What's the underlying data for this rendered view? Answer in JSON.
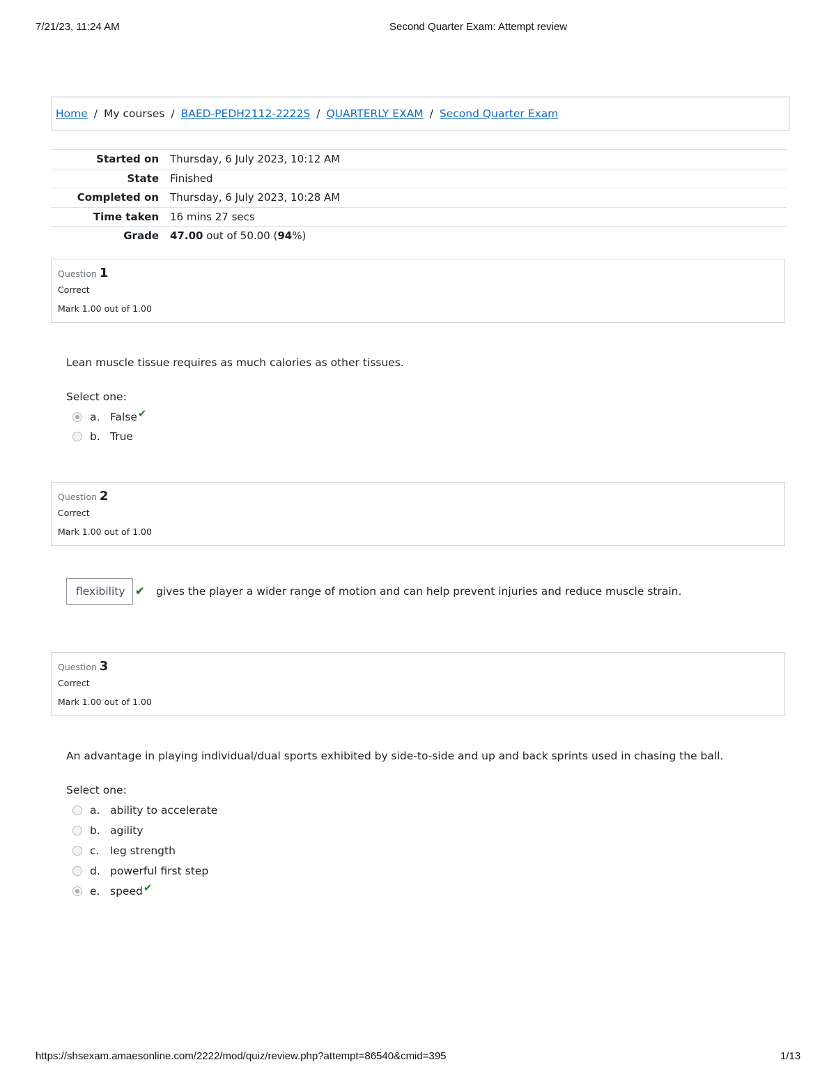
{
  "print_header": {
    "datetime": "7/21/23, 11:24 AM",
    "title": "Second Quarter Exam: Attempt review"
  },
  "print_footer": {
    "url": "https://shsexam.amaesonline.com/2222/mod/quiz/review.php?attempt=86540&cmid=395",
    "page": "1/13"
  },
  "breadcrumb": [
    {
      "label": "Home",
      "link": true
    },
    {
      "label": "My courses",
      "link": false
    },
    {
      "label": "BAED-PEDH2112-2222S",
      "link": true
    },
    {
      "label": "QUARTERLY EXAM",
      "link": true
    },
    {
      "label": "Second Quarter Exam",
      "link": true
    }
  ],
  "breadcrumb_separator": "/",
  "summary": {
    "started_on": {
      "label": "Started on",
      "value": "Thursday, 6 July 2023, 10:12 AM"
    },
    "state": {
      "label": "State",
      "value": "Finished"
    },
    "completed_on": {
      "label": "Completed on",
      "value": "Thursday, 6 July 2023, 10:28 AM"
    },
    "time_taken": {
      "label": "Time taken",
      "value": "16 mins 27 secs"
    },
    "grade": {
      "label": "Grade",
      "score": "47.00",
      "middle": " out of 50.00 (",
      "percent": "94",
      "end": "%)"
    }
  },
  "questions": [
    {
      "label": "Question",
      "number": "1",
      "state": "Correct",
      "mark": "Mark 1.00 out of 1.00",
      "text": "Lean muscle tissue requires as much calories as other tissues.",
      "prompt": "Select one:",
      "options": [
        {
          "letter": "a.",
          "text": "False",
          "selected": true,
          "correct": true
        },
        {
          "letter": "b.",
          "text": "True",
          "selected": false,
          "correct": false
        }
      ]
    },
    {
      "label": "Question",
      "number": "2",
      "state": "Correct",
      "mark": "Mark 1.00 out of 1.00",
      "answer": "flexibility",
      "text_after": "gives the player a wider range of motion and can help prevent injuries and reduce muscle strain."
    },
    {
      "label": "Question",
      "number": "3",
      "state": "Correct",
      "mark": "Mark 1.00 out of 1.00",
      "text": "An advantage in playing individual/dual sports exhibited by side-to-side and up and back sprints used in chasing the ball.",
      "prompt": "Select one:",
      "options": [
        {
          "letter": "a.",
          "text": "ability to accelerate",
          "selected": false,
          "correct": false
        },
        {
          "letter": "b.",
          "text": "agility",
          "selected": false,
          "correct": false
        },
        {
          "letter": "c.",
          "text": "leg strength",
          "selected": false,
          "correct": false
        },
        {
          "letter": "d.",
          "text": "powerful first step",
          "selected": false,
          "correct": false
        },
        {
          "letter": "e.",
          "text": "speed",
          "selected": true,
          "correct": true
        }
      ]
    }
  ],
  "icons": {
    "correct": "check-icon"
  },
  "colors": {
    "link": "#0f6cbf",
    "correct": "#357a32",
    "border": "#cfd4d9"
  }
}
